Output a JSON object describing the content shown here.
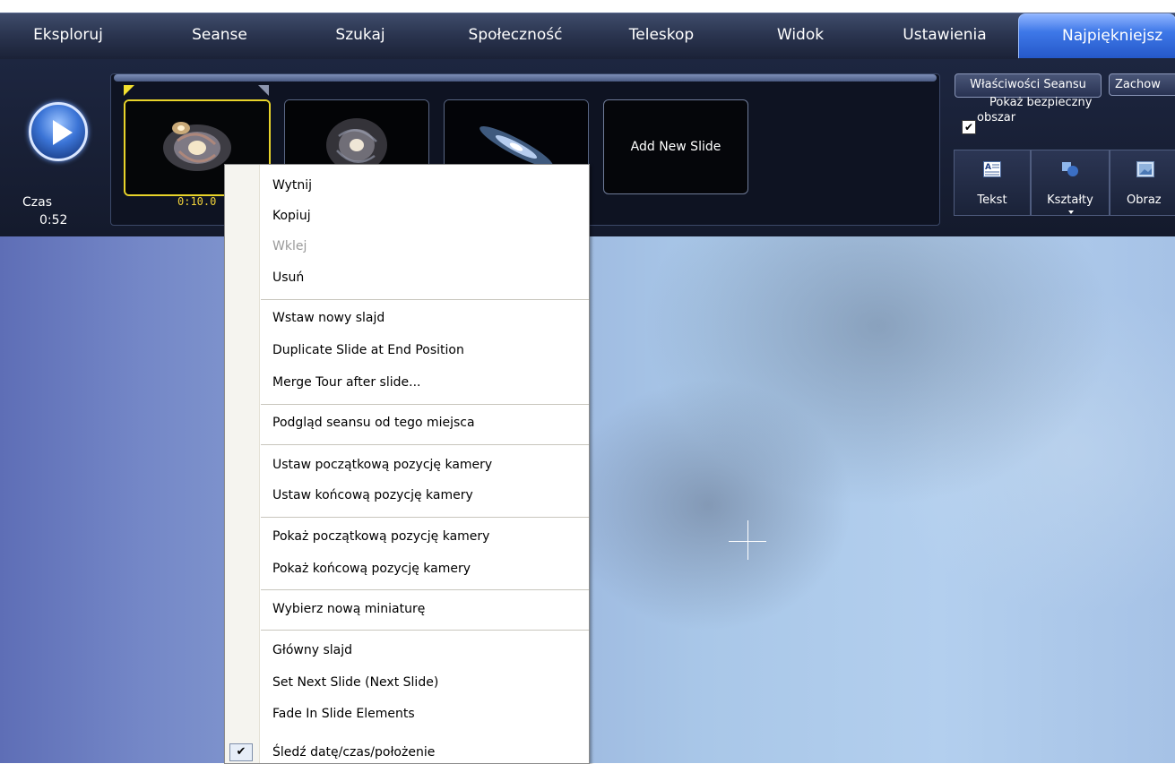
{
  "nav": {
    "items": [
      {
        "label": "Eksploruj"
      },
      {
        "label": "Seanse"
      },
      {
        "label": "Szukaj"
      },
      {
        "label": "Społeczność"
      },
      {
        "label": "Teleskop"
      },
      {
        "label": "Widok"
      },
      {
        "label": "Ustawienia"
      },
      {
        "label": "Najpiękniejsz"
      }
    ]
  },
  "tour": {
    "time_label": "Czas",
    "time_value": "0:52",
    "play_icon": "play-icon",
    "slides": [
      {
        "time": "0:10.0",
        "thumb": "spiral-galaxy-m51",
        "selected": true
      },
      {
        "time": "",
        "thumb": "spiral-galaxy-m101",
        "selected": false
      },
      {
        "time": "",
        "thumb": "edge-on-galaxy",
        "selected": false
      }
    ],
    "add_slide_label": "Add New Slide"
  },
  "tools": {
    "tour_properties": "Właściwości Seansu",
    "save": "Zachow",
    "safe_area_label": "Pokaż bezpieczny obszar",
    "safe_area_checked": true,
    "buttons": [
      {
        "label": "Tekst",
        "icon": "text-icon"
      },
      {
        "label": "Kształty",
        "icon": "shapes-icon"
      },
      {
        "label": "Obraz",
        "icon": "image-icon"
      }
    ]
  },
  "context_menu": {
    "items": [
      {
        "label": "Wytnij",
        "disabled": false
      },
      {
        "label": "Kopiuj",
        "disabled": false
      },
      {
        "label": "Wklej",
        "disabled": true
      },
      {
        "label": "Usuń",
        "disabled": false
      },
      {
        "label": "Wstaw nowy slajd",
        "disabled": false
      },
      {
        "label": "Duplicate Slide at End Position",
        "disabled": false
      },
      {
        "label": "Merge Tour after slide...",
        "disabled": false
      },
      {
        "label": "Podgląd seansu od tego miejsca",
        "disabled": false
      },
      {
        "label": "Ustaw początkową pozycję kamery",
        "disabled": false
      },
      {
        "label": "Ustaw końcową pozycję kamery",
        "disabled": false
      },
      {
        "label": "Pokaż początkową pozycję kamery",
        "disabled": false
      },
      {
        "label": "Pokaż końcową pozycję kamery",
        "disabled": false
      },
      {
        "label": "Wybierz nową miniaturę",
        "disabled": false
      },
      {
        "label": "Główny slajd",
        "disabled": false
      },
      {
        "label": "Set Next Slide (Next Slide)",
        "disabled": false
      },
      {
        "label": "Fade In Slide Elements",
        "disabled": false
      },
      {
        "label": "Śledź datę/czas/położenie",
        "disabled": false,
        "checked": true
      }
    ]
  },
  "colors": {
    "nav_active": "#3e78e8",
    "slide_selected_border": "#e8d32a",
    "slide_time": "#f1d23a"
  }
}
